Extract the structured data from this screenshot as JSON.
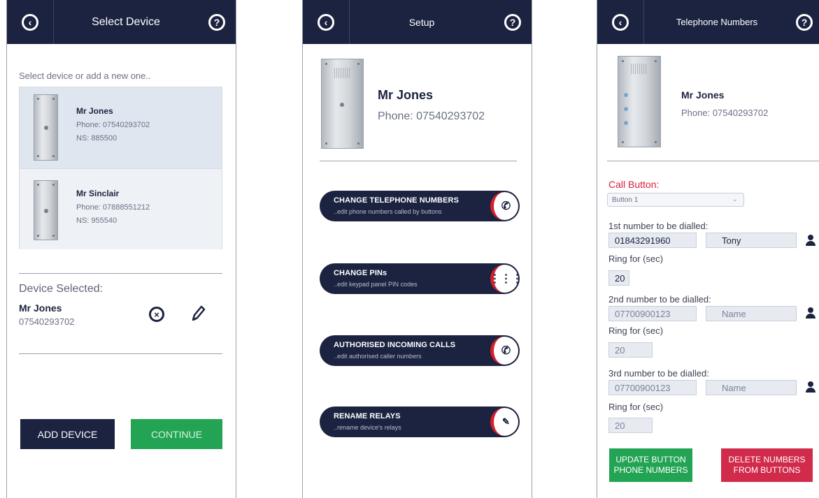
{
  "screen1": {
    "title": "Select Device",
    "prompt": "Select device or add a new one..",
    "devices": [
      {
        "name": "Mr Jones",
        "phone": "Phone: 07540293702",
        "ns": "NS: 885500"
      },
      {
        "name": "Mr Sinclair",
        "phone": "Phone: 07888551212",
        "ns": "NS: 955540"
      }
    ],
    "selected_header": "Device Selected:",
    "selected_name": "Mr Jones",
    "selected_phone": "07540293702",
    "add_label": "ADD DEVICE",
    "continue_label": "CONTINUE"
  },
  "screen2": {
    "title": "Setup",
    "name": "Mr Jones",
    "phone": "Phone: 07540293702",
    "menu": [
      {
        "label": "CHANGE TELEPHONE NUMBERS",
        "sub": "..edit phone numbers called by buttons",
        "icon": "phone-switch-icon"
      },
      {
        "label": "CHANGE PINs",
        "sub": "..edit keypad panel PIN codes",
        "icon": "keypad-icon"
      },
      {
        "label": "AUTHORISED INCOMING CALLS",
        "sub": "..edit authorised caller numbers",
        "icon": "phone-switch-icon"
      },
      {
        "label": "RENAME RELAYS",
        "sub": "..rename device's relays",
        "icon": "relay-edit-icon"
      }
    ]
  },
  "screen3": {
    "title": "Telephone Numbers",
    "name": "Mr Jones",
    "phone": "Phone: 07540293702",
    "call_button_label": "Call Button:",
    "call_button_value": "Button 1",
    "numbers": [
      {
        "label": "1st number to be dialled:",
        "number": "01843291960",
        "name": "Tony",
        "ring_label": "Ring for (sec)",
        "ring": "20"
      },
      {
        "label": "2nd number to be dialled:",
        "number": "07700900123",
        "name": "Name",
        "ring_label": "Ring for (sec)",
        "ring": "20"
      },
      {
        "label": "3rd number to be dialled:",
        "number": "07700900123",
        "name": "Name",
        "ring_label": "Ring for (sec)",
        "ring": "20"
      }
    ],
    "update_label": "UPDATE BUTTON PHONE NUMBERS",
    "delete_label": "DELETE NUMBERS FROM BUTTONS"
  },
  "colors": {
    "navy": "#1c2340",
    "green": "#23a454",
    "red": "#d12a4a",
    "accent_red": "#d6202d"
  }
}
